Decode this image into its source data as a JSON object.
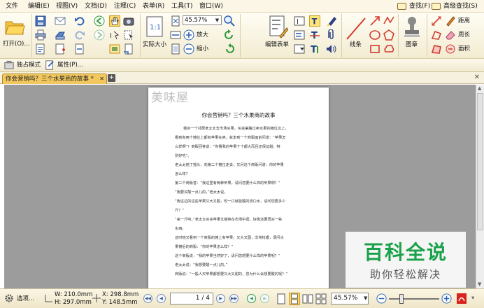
{
  "menu": {
    "items": [
      "文件",
      "编辑(E)",
      "视图(V)",
      "文档(D)",
      "注释(C)",
      "表单(R)",
      "工具(T)",
      "窗口(W)"
    ],
    "find": "查找(F)",
    "advanced_find": "高级查找(S)"
  },
  "ribbon": {
    "open_label": "打开(O)...",
    "zoom_value": "45.57%",
    "zoom_in": "放大",
    "zoom_out": "缩小",
    "actual_size": "实际大小",
    "edit_form": "编辑表单",
    "lines": "线条",
    "stamp": "图章",
    "distance": "距离",
    "perimeter": "周长",
    "area": "面积"
  },
  "toolbar2": {
    "exclusive_mode": "独占模式",
    "properties": "属性(P)..."
  },
  "tabs": [
    {
      "label": "你会营销吗？三个水果商的故事 *"
    }
  ],
  "doc": {
    "logo": "美味屋",
    "title": "你会营销吗？三个水果商的故事",
    "lines": [
      "我的一个邻居老太太去市场买果，买完第路过卖水果的摊位边上，",
      "看到有两个摊位上都有苹果在卖，就走到一个商贩面前问道：“苹果怎",
      "么样啊”？商贩回答说：“你看我的苹果个个都大而且还保证甜，特",
      "别好吃”。",
      "老太太摇了摇头，向第二个摊位走去，又问这个商贩问道：你的苹果",
      "怎么样？",
      "第二个商贩答：“我这里有两种苹果，请问您要什么样的苹果啊？”",
      "“我要买酸一点儿的，”老太太说。",
      "“我这边的这些苹果又大又酸，咬一口就能酸的流口水，请问您要多少",
      "斤？”",
      "“来一斤吧，”老太太买完苹果又继续在市场中逛，好像还要再买一些",
      "东西。",
      "这时她又看到一个商贩的摊上有苹果，又大又圆，非常抢眼，便问水",
      "果摊后的商贩：“你的苹果怎么样？”",
      "这个商贩说：“我的苹果当然好了，请问您想要什么样的苹果呢？”",
      "老太太说：“我想要酸一点儿的。”",
      "商贩说：“一般人买苹果都想要又大又甜的，您为什么会想要酸的呢？”"
    ]
  },
  "status": {
    "options": "选项...",
    "width": "W: 210.0mm",
    "height": "H: 297.0mm",
    "x": "X: 298.8mm",
    "y": "Y: 148.5mm",
    "page_display": "1 / 4",
    "zoom_value": "45.57%"
  },
  "watermark": {
    "title": "百科全说",
    "subtitle": "助你轻松解决"
  }
}
